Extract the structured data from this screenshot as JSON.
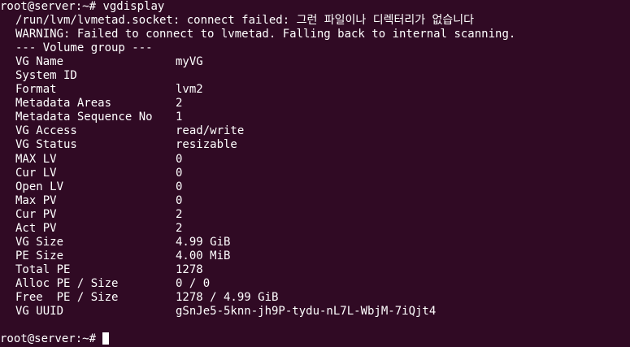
{
  "command_line": {
    "prompt": "root@server:~#",
    "command": "vgdisplay"
  },
  "messages": [
    "/run/lvm/lvmetad.socket: connect failed: 그런 파일이나 디렉터리가 없습니다",
    "WARNING: Failed to connect to lvmetad. Falling back to internal scanning."
  ],
  "section_header": "--- Volume group ---",
  "fields": [
    {
      "key": "VG Name",
      "value": "myVG"
    },
    {
      "key": "System ID",
      "value": ""
    },
    {
      "key": "Format",
      "value": "lvm2"
    },
    {
      "key": "Metadata Areas",
      "value": "2"
    },
    {
      "key": "Metadata Sequence No",
      "value": "1"
    },
    {
      "key": "VG Access",
      "value": "read/write"
    },
    {
      "key": "VG Status",
      "value": "resizable"
    },
    {
      "key": "MAX LV",
      "value": "0"
    },
    {
      "key": "Cur LV",
      "value": "0"
    },
    {
      "key": "Open LV",
      "value": "0"
    },
    {
      "key": "Max PV",
      "value": "0"
    },
    {
      "key": "Cur PV",
      "value": "2"
    },
    {
      "key": "Act PV",
      "value": "2"
    },
    {
      "key": "VG Size",
      "value": "4.99 GiB"
    },
    {
      "key": "PE Size",
      "value": "4.00 MiB"
    },
    {
      "key": "Total PE",
      "value": "1278"
    },
    {
      "key": "Alloc PE / Size",
      "value": "0 / 0"
    },
    {
      "key": "Free  PE / Size",
      "value": "1278 / 4.99 GiB"
    },
    {
      "key": "VG UUID",
      "value": "gSnJe5-5knn-jh9P-tydu-nL7L-WbjM-7iQjt4"
    }
  ],
  "final_prompt": {
    "prompt": "root@server:~#"
  }
}
